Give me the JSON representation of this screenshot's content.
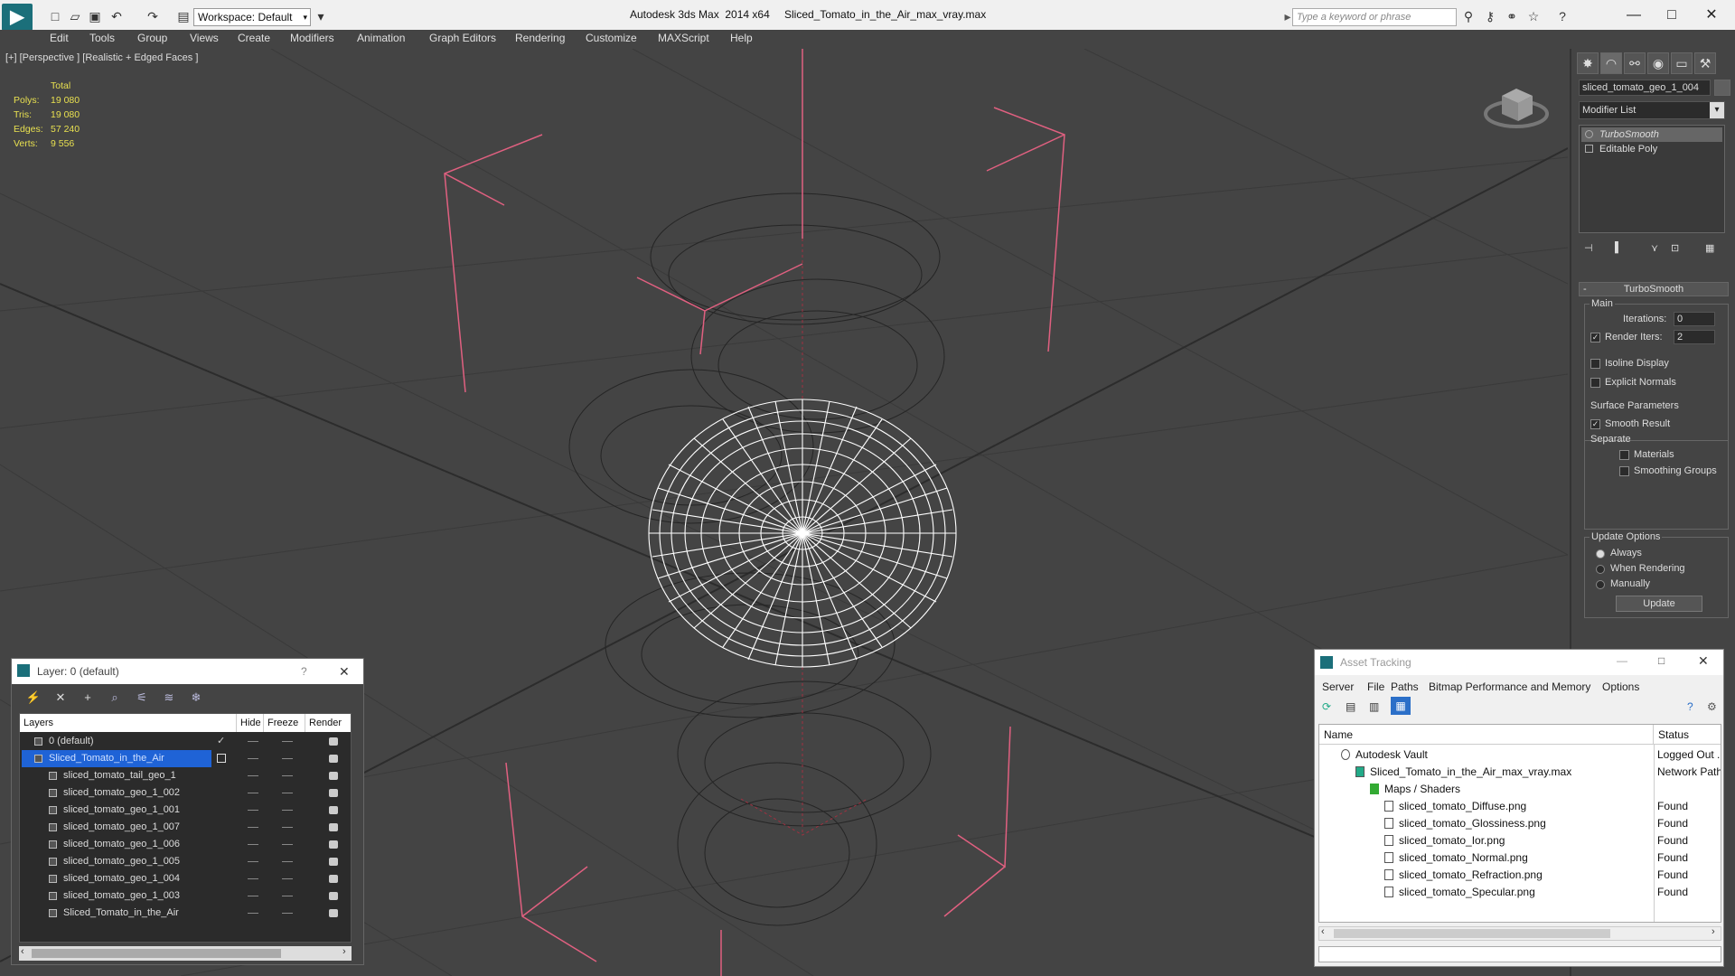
{
  "titlebar": {
    "workspace_label": "Workspace: Default",
    "app_title": "Autodesk 3ds Max  2014 x64",
    "doc_title": "Sliced_Tomato_in_the_Air_max_vray.max",
    "search_placeholder": "Type a keyword or phrase"
  },
  "menu": [
    "Edit",
    "Tools",
    "Group",
    "Views",
    "Create",
    "Modifiers",
    "Animation",
    "Graph Editors",
    "Rendering",
    "Customize",
    "MAXScript",
    "Help"
  ],
  "viewport": {
    "label": "[+] [Perspective ] [Realistic + Edged Faces ]",
    "stats": {
      "header": "Total",
      "rows": [
        {
          "label": "Polys:",
          "value": "19 080"
        },
        {
          "label": "Tris:",
          "value": "19 080"
        },
        {
          "label": "Edges:",
          "value": "57 240"
        },
        {
          "label": "Verts:",
          "value": "9 556"
        }
      ]
    }
  },
  "command_panel": {
    "object_name": "sliced_tomato_geo_1_004",
    "modifier_list": "Modifier List",
    "stack": [
      "TurboSmooth",
      "Editable Poly"
    ],
    "rollout_title": "TurboSmooth",
    "main_group": "Main",
    "iterations_label": "Iterations:",
    "iterations_value": "0",
    "render_iters_label": "Render Iters:",
    "render_iters_value": "2",
    "isoline_label": "Isoline Display",
    "explicit_normals_label": "Explicit Normals",
    "surface_group": "Surface Parameters",
    "smooth_result_label": "Smooth Result",
    "separate_label": "Separate",
    "materials_label": "Materials",
    "smoothing_groups_label": "Smoothing Groups",
    "update_group": "Update Options",
    "always_label": "Always",
    "when_rendering_label": "When Rendering",
    "manually_label": "Manually",
    "update_button": "Update"
  },
  "layer_panel": {
    "title": "Layer: 0 (default)",
    "help": "?",
    "close": "✕",
    "columns": {
      "layers": "Layers",
      "hide": "Hide",
      "freeze": "Freeze",
      "render": "Render"
    },
    "rows": [
      {
        "name": "0 (default)"
      },
      {
        "name": "Sliced_Tomato_in_the_Air"
      },
      {
        "name": "sliced_tomato_tail_geo_1"
      },
      {
        "name": "sliced_tomato_geo_1_002"
      },
      {
        "name": "sliced_tomato_geo_1_001"
      },
      {
        "name": "sliced_tomato_geo_1_007"
      },
      {
        "name": "sliced_tomato_geo_1_006"
      },
      {
        "name": "sliced_tomato_geo_1_005"
      },
      {
        "name": "sliced_tomato_geo_1_004"
      },
      {
        "name": "sliced_tomato_geo_1_003"
      },
      {
        "name": "Sliced_Tomato_in_the_Air"
      }
    ]
  },
  "asset_tracking": {
    "title": "Asset Tracking",
    "menu": [
      "Server",
      "File",
      "Paths",
      "Bitmap Performance and Memory",
      "Options"
    ],
    "columns": {
      "name": "Name",
      "status": "Status"
    },
    "rows": [
      {
        "name": "Autodesk Vault",
        "status": "Logged Out ."
      },
      {
        "name": "Sliced_Tomato_in_the_Air_max_vray.max",
        "status": "Network Path"
      },
      {
        "name": "Maps / Shaders",
        "status": ""
      },
      {
        "name": "sliced_tomato_Diffuse.png",
        "status": "Found"
      },
      {
        "name": "sliced_tomato_Glossiness.png",
        "status": "Found"
      },
      {
        "name": "sliced_tomato_Ior.png",
        "status": "Found"
      },
      {
        "name": "sliced_tomato_Normal.png",
        "status": "Found"
      },
      {
        "name": "sliced_tomato_Refraction.png",
        "status": "Found"
      },
      {
        "name": "sliced_tomato_Specular.png",
        "status": "Found"
      }
    ]
  },
  "colors": {
    "viewport_bg": "#444444",
    "stat_text": "#e8e050",
    "bbox_lines": "#e06080",
    "selection_blue": "#1f63d6",
    "wire_selected": "#ffffff",
    "wire_ghost": "#2a2a2a"
  }
}
